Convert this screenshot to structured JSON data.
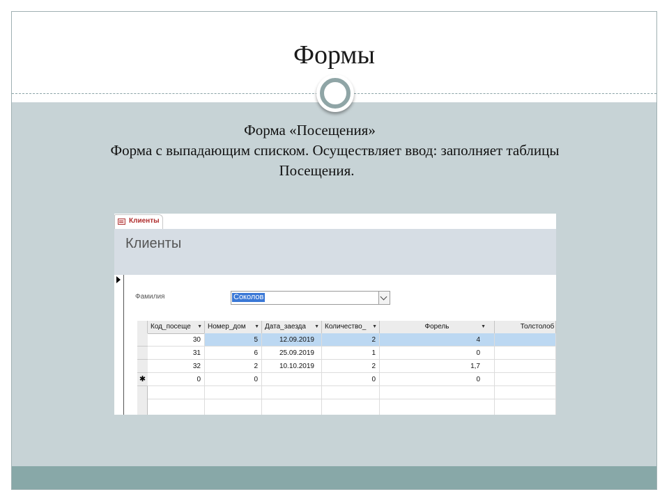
{
  "slide": {
    "title": "Формы",
    "subtitle": "Форма «Посещения»",
    "desc_line1": "Форма с выпадающим списком. Осуществляет ввод: заполняет таблицы",
    "desc_line2": "Посещения."
  },
  "access_window": {
    "tab_label": "Клиенты",
    "form_title": "Клиенты",
    "field_label": "Фамилия",
    "combo_value": "Соколов",
    "columns": [
      "Код_посеще",
      "Номер_дом",
      "Дата_заезда",
      "Количество_",
      "Форель",
      "Толстолоб"
    ],
    "rows": [
      [
        "30",
        "5",
        "12.09.2019",
        "2",
        "4",
        ""
      ],
      [
        "31",
        "6",
        "25.09.2019",
        "1",
        "0",
        ""
      ],
      [
        "32",
        "2",
        "10.10.2019",
        "2",
        "1,7",
        ""
      ],
      [
        "0",
        "0",
        "",
        "0",
        "0",
        ""
      ]
    ],
    "new_record_marker": "✱"
  },
  "colors": {
    "body_background": "#c7d3d6",
    "footer_band": "#88a8a8",
    "selected_row": "#bcd8f2",
    "combo_selection": "#3a78d6"
  },
  "icons": [
    "form-tab-icon",
    "record-selector-arrow-icon",
    "dropdown-chevron-icon",
    "new-record-icon"
  ]
}
